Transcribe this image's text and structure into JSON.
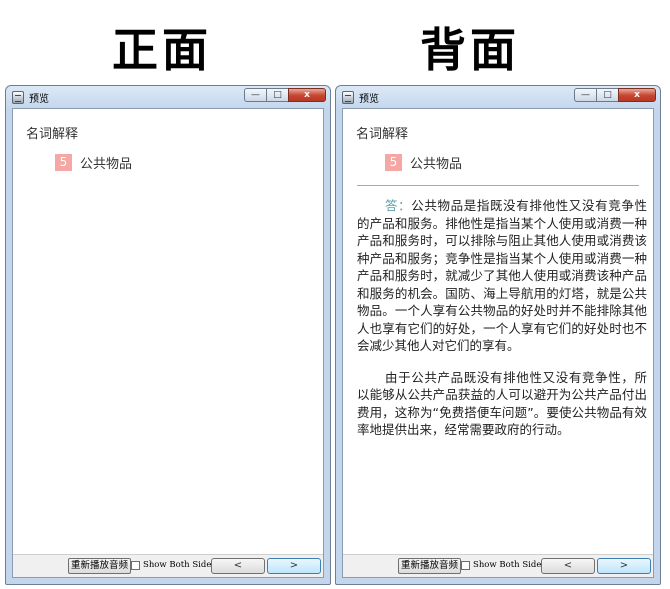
{
  "headings": {
    "front": "正面",
    "back": "背面"
  },
  "window": {
    "title": "预览",
    "min_glyph": "—",
    "max_glyph": "□",
    "close_glyph": "x"
  },
  "card": {
    "deck_name": "名词解释",
    "number": "5",
    "word": "公共物品",
    "answer_label": "答：",
    "answer_p1": "公共物品是指既没有排他性又没有竞争性的产品和服务。排他性是指当某个人使用或消费一种产品和服务时，可以排除与阻止其他人使用或消费该种产品和服务；竞争性是指当某个人使用或消费一种产品和服务时，就减少了其他人使用或消费该种产品和服务的机会。国防、海上导航用的灯塔，就是公共物品。一个人享有公共物品的好处时并不能排除其他人也享有它们的好处，一个人享有它们的好处时也不会减少其他人对它们的享有。",
    "answer_p2": "由于公共产品既没有排他性又没有竞争性，所以能够从公共产品获益的人可以避开为公共产品付出费用，这称为“免费搭便车问题”。要使公共物品有效率地提供出来，经常需要政府的行动。"
  },
  "bottom": {
    "replay_label": "重新播放音频",
    "both_sides_label": "Show Both Sides",
    "prev_label": "<",
    "next_label": ">"
  }
}
